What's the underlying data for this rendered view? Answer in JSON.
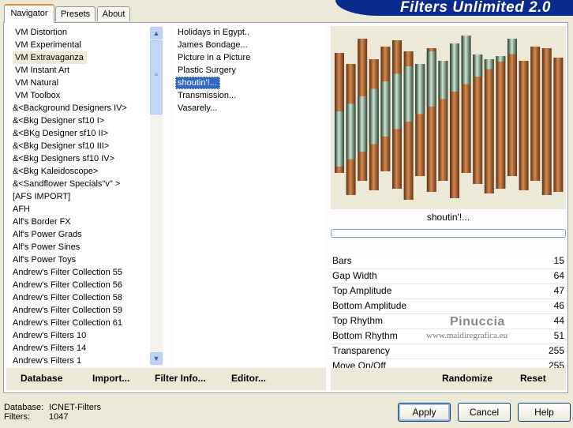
{
  "tabs": [
    "Navigator",
    "Presets",
    "About"
  ],
  "banner_title": "Filters Unlimited 2.0",
  "categories": [
    "VM Distortion",
    "VM Experimental",
    "VM Extravaganza",
    "VM Instant Art",
    "VM Natural",
    "VM Toolbox",
    "&<Background Designers IV>",
    "&<Bkg Designer sf10 I>",
    "&<BKg Designer sf10 II>",
    "&<Bkg Designer sf10 III>",
    "&<Bkg Designers sf10 IV>",
    "&<Bkg Kaleidoscope>",
    "&<Sandflower Specials\"v\" >",
    "[AFS IMPORT]",
    "AFH",
    "Alf's Border FX",
    "Alf's Power Grads",
    "Alf's Power Sines",
    "Alf's Power Toys",
    "Andrew's Filter Collection 55",
    "Andrew's Filter Collection 56",
    "Andrew's Filter Collection 58",
    "Andrew's Filter Collection 59",
    "Andrew's Filter Collection 61",
    "Andrew's Filters 10",
    "Andrew's Filters 14",
    "Andrew's Filters 1"
  ],
  "selected_category": "VM Extravaganza",
  "filters": [
    "Holidays in Egypt..",
    "James Bondage...",
    "Picture in a Picture",
    "Plastic Surgery",
    "shoutin'!...",
    "Transmission...",
    "Vasarely..."
  ],
  "selected_filter": "shoutin'!...",
  "left_buttons": {
    "database": "Database",
    "import": "Import...",
    "filter_info": "Filter Info...",
    "editor": "Editor..."
  },
  "preview_name": "shoutin'!...",
  "params": [
    {
      "label": "Bars",
      "value": "15"
    },
    {
      "label": "Gap Width",
      "value": "64"
    },
    {
      "label": "Top Amplitude",
      "value": "47"
    },
    {
      "label": "Bottom Amplitude",
      "value": "46"
    },
    {
      "label": "Top Rhythm",
      "value": "44"
    },
    {
      "label": "Bottom Rhythm",
      "value": "51"
    },
    {
      "label": "Transparency",
      "value": "255"
    },
    {
      "label": "Move On/Off",
      "value": "255"
    }
  ],
  "watermark": {
    "name": "Pinuccia",
    "url": "www.maidiregrafica.eu"
  },
  "right_buttons": {
    "randomize": "Randomize",
    "reset": "Reset"
  },
  "status": {
    "db_label": "Database:",
    "db_value": "ICNET-Filters",
    "filters_label": "Filters:",
    "filters_value": "1047"
  },
  "dialog_buttons": {
    "apply": "Apply",
    "cancel": "Cancel",
    "help": "Help"
  },
  "colors": {
    "selection": "#316ac5",
    "banner": "#0a2a8c",
    "copper": "#b5703e",
    "sage": "#8fb59a"
  }
}
